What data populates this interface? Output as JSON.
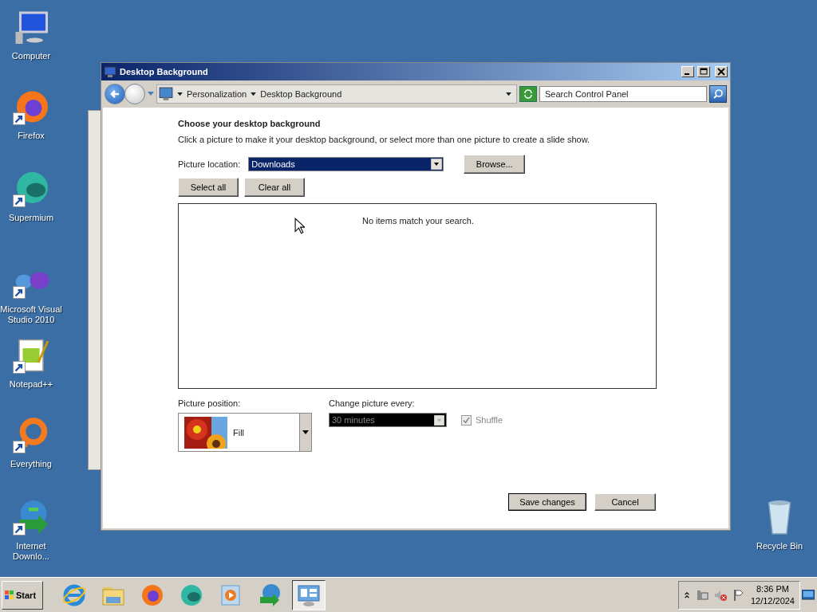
{
  "desktop_icons": [
    {
      "label": "Computer",
      "kind": "computer",
      "shortcut": false
    },
    {
      "label": "Firefox",
      "kind": "firefox",
      "shortcut": true
    },
    {
      "label": "Supermium",
      "kind": "supermium",
      "shortcut": true
    },
    {
      "label": "Microsoft Visual Studio 2010",
      "kind": "vs",
      "shortcut": true
    },
    {
      "label": "Notepad++",
      "kind": "notepad",
      "shortcut": true
    },
    {
      "label": "Everything",
      "kind": "everything",
      "shortcut": true
    },
    {
      "label": "Internet Downlo...",
      "kind": "idm",
      "shortcut": true
    }
  ],
  "recycle_bin": {
    "label": "Recycle Bin"
  },
  "window": {
    "title": "Desktop Background",
    "breadcrumb": [
      "Personalization",
      "Desktop Background"
    ],
    "search": {
      "placeholder": "Search Control Panel"
    },
    "heading": "Choose your desktop background",
    "description": "Click a picture to make it your desktop background, or select more than one picture to create a slide show.",
    "location_label": "Picture location:",
    "location": {
      "value": "Downloads",
      "highlighted": true
    },
    "browse": "Browse...",
    "select_all": "Select all",
    "clear_all": "Clear all",
    "empty_message": "No items match your search.",
    "position_label": "Picture position:",
    "position": "Fill",
    "interval_label": "Change picture every:",
    "interval": {
      "value": "30 minutes",
      "disabled": true
    },
    "shuffle": {
      "label": "Shuffle",
      "checked": true,
      "disabled": true
    },
    "buttons": [
      {
        "label": "Save changes",
        "default": true
      },
      {
        "label": "Cancel",
        "default": false
      }
    ]
  },
  "taskbar": {
    "start": "Start",
    "apps": [
      {
        "kind": "ie",
        "selected": false
      },
      {
        "kind": "folder",
        "selected": false
      },
      {
        "kind": "firefox",
        "selected": false
      },
      {
        "kind": "supermium",
        "selected": false
      },
      {
        "kind": "media",
        "selected": false
      },
      {
        "kind": "idm",
        "selected": false
      },
      {
        "kind": "control",
        "selected": true
      }
    ],
    "clock": {
      "time": "8:36 PM",
      "date": "12/12/2024"
    }
  }
}
